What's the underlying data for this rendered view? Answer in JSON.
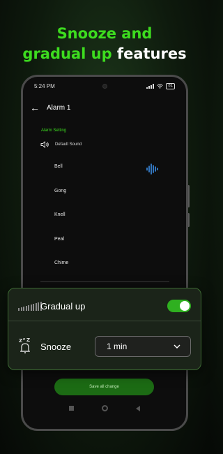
{
  "headline": {
    "line1": "Snooze and",
    "line2_green": "gradual up",
    "line2_white": " features"
  },
  "status_bar": {
    "time": "5:24 PM",
    "battery": "81"
  },
  "appbar": {
    "title": "Alarm 1"
  },
  "settings": {
    "section_label": "Alarm Setting",
    "default_sound": "Default Sound",
    "sounds": [
      "Bell",
      "Gong",
      "Knell",
      "Peal",
      "Chime"
    ]
  },
  "overlay": {
    "gradual_up_label": "Gradual up",
    "gradual_up_on": true,
    "snooze_label": "Snooze",
    "snooze_value": "1 min"
  },
  "save_button": "Save all change",
  "colors": {
    "accent": "#3ddc1f",
    "toggle_on": "#2fb020",
    "wave": "#3b8fe8"
  },
  "icons": [
    "back-arrow-icon",
    "speaker-icon",
    "sound-wave-icon",
    "gradual-volume-icon",
    "snooze-zzz-icon",
    "chevron-down-icon"
  ]
}
